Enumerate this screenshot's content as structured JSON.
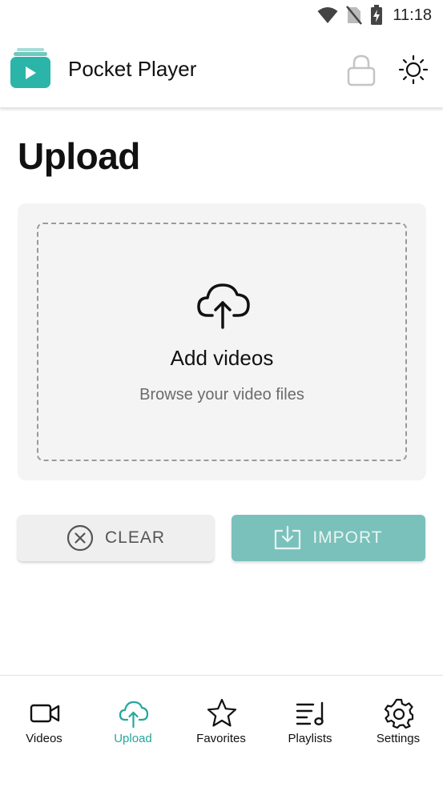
{
  "status_bar": {
    "time": "11:18"
  },
  "app_bar": {
    "title": "Pocket Player"
  },
  "page": {
    "title": "Upload"
  },
  "drop_zone": {
    "title": "Add videos",
    "subtitle": "Browse your video files"
  },
  "actions": {
    "clear_label": "CLEAR",
    "import_label": "IMPORT"
  },
  "bottom_nav": {
    "items": [
      {
        "label": "Videos",
        "icon": "video-camera-icon"
      },
      {
        "label": "Upload",
        "icon": "cloud-upload-icon",
        "active": true
      },
      {
        "label": "Favorites",
        "icon": "star-icon"
      },
      {
        "label": "Playlists",
        "icon": "playlist-icon"
      },
      {
        "label": "Settings",
        "icon": "gear-icon"
      }
    ]
  },
  "colors": {
    "accent": "#26a79b",
    "import_disabled": "#7ac1bb",
    "logo": "#2bb5a8"
  }
}
